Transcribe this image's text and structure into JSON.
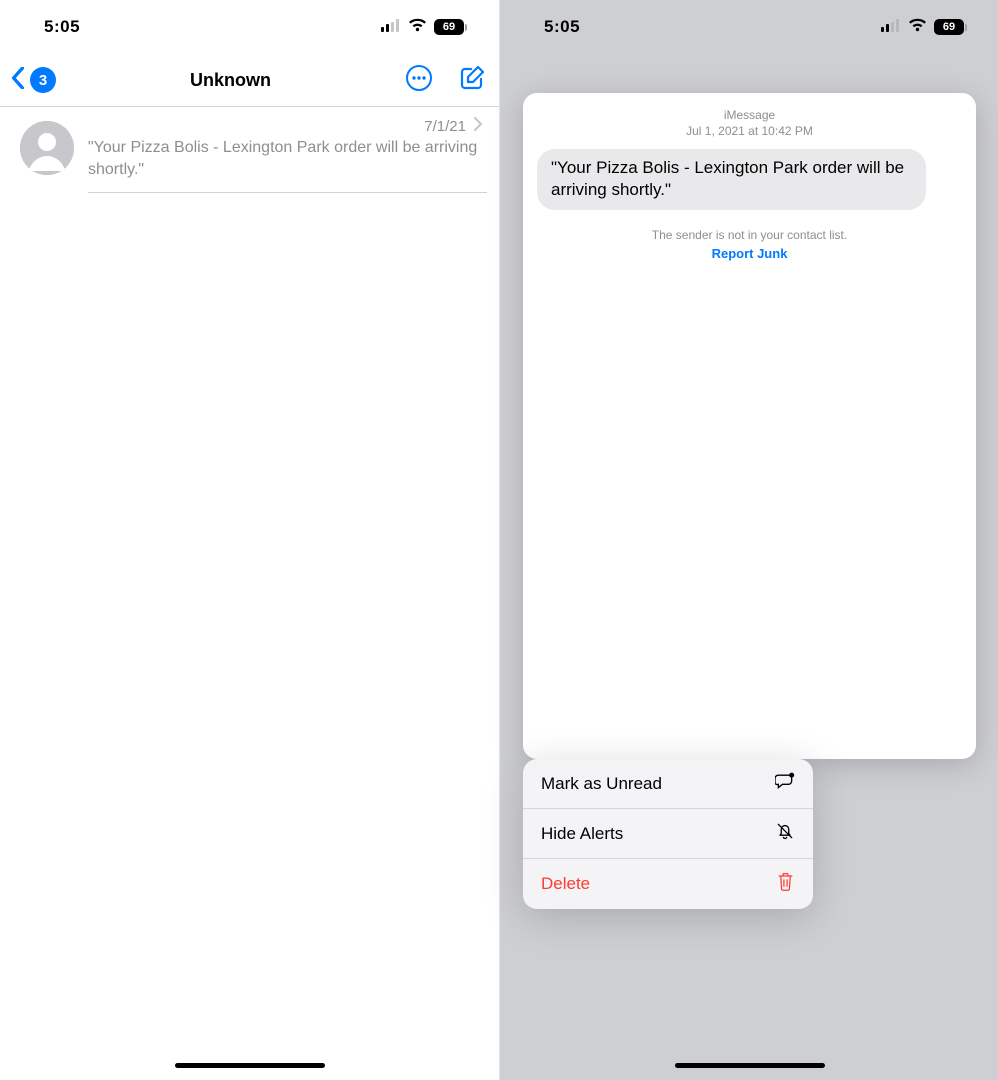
{
  "status": {
    "time": "5:05",
    "battery_label": "69"
  },
  "left": {
    "unread_count": "3",
    "title": "Unknown",
    "row": {
      "date": "7/1/21",
      "snippet": "\"Your Pizza Bolis - Lexington Park order will be arriving shortly.\""
    }
  },
  "right": {
    "preview": {
      "header_line1": "iMessage",
      "header_line2": "Jul 1, 2021 at 10:42 PM",
      "bubble_text": "\"Your Pizza Bolis - Lexington Park order will be arriving shortly.\"",
      "sender_note": "The sender is not in your contact list.",
      "report_junk": "Report Junk"
    },
    "menu": {
      "mark_unread": "Mark as Unread",
      "hide_alerts": "Hide Alerts",
      "delete": "Delete"
    }
  }
}
